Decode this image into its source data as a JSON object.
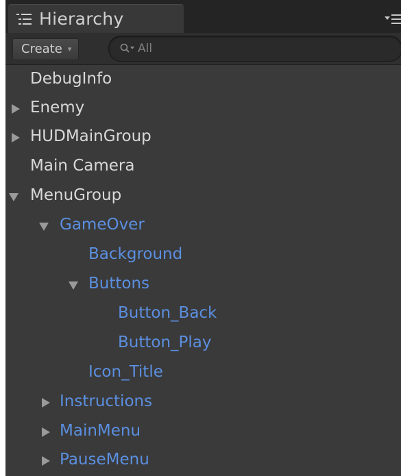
{
  "panel": {
    "tab_title": "Hierarchy",
    "tab_icon": "list-icon",
    "menu_icon": "panel-menu-icon"
  },
  "toolbar": {
    "create_label": "Create",
    "create_caret": "▾",
    "search_placeholder": "All",
    "search_value": ""
  },
  "colors": {
    "panel_bg": "#3a3a3a",
    "tab_bg": "#383838",
    "tabbar_bg": "#242424",
    "toolbar_bg": "#2f2f2f",
    "text_normal": "#d8d8d8",
    "text_prefab": "#5b8fe0",
    "arrow": "#9a9a9a"
  },
  "tree": [
    {
      "label": "DebugInfo",
      "expander": "none",
      "style": "normal"
    },
    {
      "label": "Enemy",
      "expander": "collapsed",
      "style": "normal"
    },
    {
      "label": "HUDMainGroup",
      "expander": "collapsed",
      "style": "normal"
    },
    {
      "label": "Main Camera",
      "expander": "none",
      "style": "normal"
    },
    {
      "label": "MenuGroup",
      "expander": "expanded",
      "style": "normal"
    },
    {
      "label": "GameOver",
      "expander": "expanded",
      "style": "prefab"
    },
    {
      "label": "Background",
      "expander": "none",
      "style": "prefab"
    },
    {
      "label": "Buttons",
      "expander": "expanded",
      "style": "prefab"
    },
    {
      "label": "Button_Back",
      "expander": "none",
      "style": "prefab"
    },
    {
      "label": "Button_Play",
      "expander": "none",
      "style": "prefab"
    },
    {
      "label": "Icon_Title",
      "expander": "none",
      "style": "prefab"
    },
    {
      "label": "Instructions",
      "expander": "collapsed",
      "style": "prefab"
    },
    {
      "label": "MainMenu",
      "expander": "collapsed",
      "style": "prefab"
    },
    {
      "label": "PauseMenu",
      "expander": "collapsed",
      "style": "prefab"
    }
  ]
}
